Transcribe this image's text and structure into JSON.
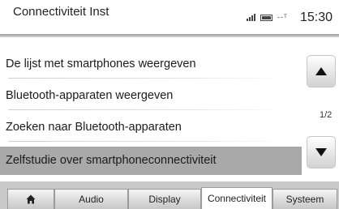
{
  "header": {
    "title": "Connectiviteit Inst",
    "network_text": "--ᵀ",
    "time": "15:30"
  },
  "menu": {
    "items": [
      {
        "label": "De lijst met smartphones weergeven",
        "selected": false
      },
      {
        "label": "Bluetooth-apparaten weergeven",
        "selected": false
      },
      {
        "label": "Zoeken naar Bluetooth-apparaten",
        "selected": false
      },
      {
        "label": "Zelfstudie over smartphoneconnectiviteit",
        "selected": true
      }
    ]
  },
  "pagination": {
    "page_indicator": "1/2",
    "up_icon": "triangle-up-icon",
    "down_icon": "triangle-down-icon"
  },
  "tabs": [
    {
      "name": "home",
      "label": "",
      "icon": "home-icon",
      "active": false
    },
    {
      "name": "audio",
      "label": "Audio",
      "active": false
    },
    {
      "name": "display",
      "label": "Display",
      "active": false
    },
    {
      "name": "connectiviteit",
      "label": "Connectiviteit",
      "active": true
    },
    {
      "name": "systeem",
      "label": "Systeem",
      "active": false
    }
  ],
  "colors": {
    "selected_row": "#a9a9a9",
    "tabbar_background": "#c9c9c9",
    "active_tab": "#ffffff"
  }
}
